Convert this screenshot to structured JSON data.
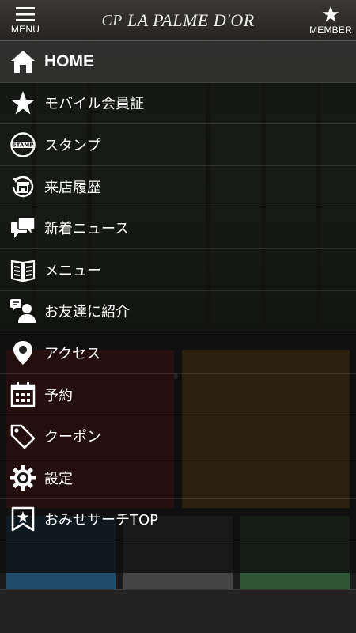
{
  "header": {
    "menu_label": "MENU",
    "title_mark": "CP",
    "title": "LA PALME D'OR",
    "member_label": "MEMBER"
  },
  "drawer": {
    "items": [
      {
        "label": "HOME",
        "icon": "home-icon"
      },
      {
        "label": "モバイル会員証",
        "icon": "star-icon"
      },
      {
        "label": "スタンプ",
        "icon": "stamp-icon"
      },
      {
        "label": "来店履歴",
        "icon": "store-history-icon"
      },
      {
        "label": "新着ニュース",
        "icon": "chat-bubbles-icon"
      },
      {
        "label": "メニュー",
        "icon": "book-icon"
      },
      {
        "label": "お友達に紹介",
        "icon": "person-speech-icon"
      },
      {
        "label": "アクセス",
        "icon": "map-pin-icon"
      },
      {
        "label": "予約",
        "icon": "calendar-icon"
      },
      {
        "label": "クーポン",
        "icon": "tag-icon"
      },
      {
        "label": "設定",
        "icon": "gear-icon"
      },
      {
        "label": "おみせサーチTOP",
        "icon": "bookmark-star-icon"
      }
    ]
  },
  "colors": {
    "header_bg": "#2f2d2a",
    "overlay": "#0c0c0c",
    "active_row": "#464646"
  }
}
